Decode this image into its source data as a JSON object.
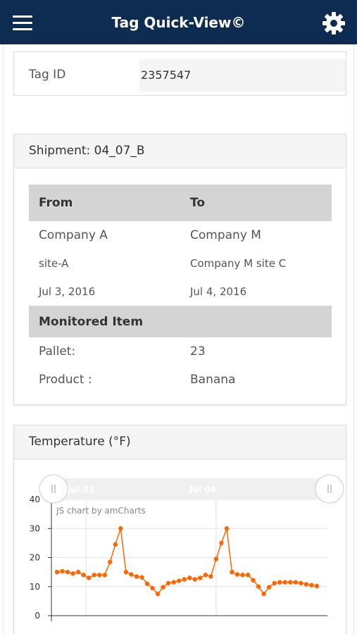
{
  "header": {
    "title": "Tag Quick-View©",
    "menu_icon": "hamburger-menu-icon",
    "settings_icon": "gear-icon"
  },
  "tag": {
    "label": "Tag ID",
    "value": "2357547"
  },
  "shipment": {
    "title": "Shipment: 04_07_B",
    "from_header": "From",
    "to_header": "To",
    "from_company": "Company A",
    "to_company": "Company M",
    "from_site": "site-A",
    "to_site": "Company M site C",
    "from_date": "Jul 3, 2016",
    "to_date": "Jul 4, 2016",
    "monitored_header": "Monitored Item",
    "pallet_label": "Pallet:",
    "pallet_value": "23",
    "product_label": "Product :",
    "product_value": "Banana"
  },
  "temperature": {
    "title": "Temperature (°F)",
    "credit": "JS chart by amCharts",
    "scrollbar_labels": [
      "Jul 03",
      "Jul 04"
    ],
    "line_color": "#ff6600"
  },
  "chart_data": {
    "type": "line",
    "title": "Temperature (°F)",
    "x_labels": [
      "Jul 03",
      "Jul 04"
    ],
    "ylim": [
      0,
      40
    ],
    "yticks": [
      0,
      10,
      20,
      30,
      40
    ],
    "grid": true,
    "series": [
      {
        "values": [
          15,
          15.3,
          15,
          14.5,
          15,
          14,
          13,
          14,
          14,
          14,
          18.5,
          24.5,
          30,
          15,
          14.2,
          13.5,
          13.2,
          11,
          9.5,
          7.5,
          9.8,
          11.2,
          11.5,
          12,
          12.5,
          13,
          12.5,
          13,
          14,
          13.5,
          19.5,
          25,
          30,
          15,
          14.2,
          14,
          14,
          12.2,
          10,
          7.5,
          9.8,
          11.2,
          11.5,
          11.5,
          11.5,
          11.5,
          11.2,
          10.8,
          10.5,
          10.2
        ]
      }
    ]
  }
}
